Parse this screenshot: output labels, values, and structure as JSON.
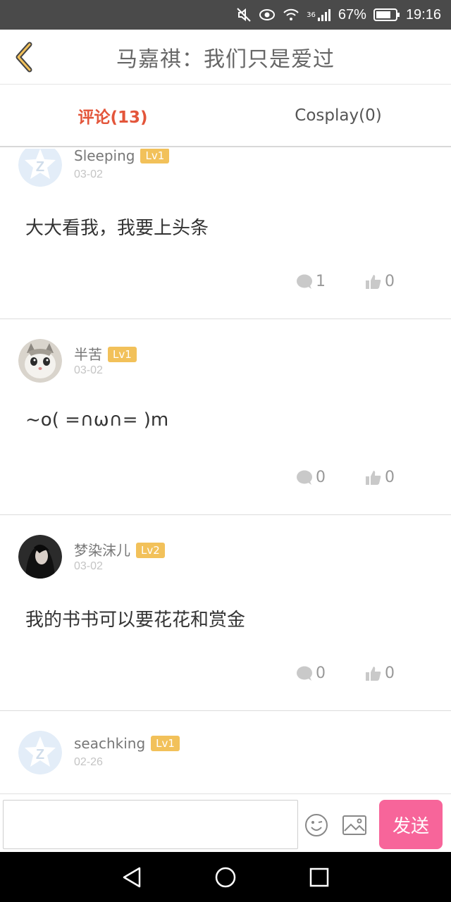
{
  "status_bar": {
    "battery": "67%",
    "time": "19:16",
    "network": "36"
  },
  "header": {
    "title": "马嘉祺：我们只是爱过"
  },
  "tabs": [
    {
      "label": "评论(13)",
      "active": true
    },
    {
      "label": "Cosplay(0)",
      "active": false
    }
  ],
  "comments": [
    {
      "username": "Sleeping",
      "level": "Lv1",
      "date": "03-02",
      "content": "大大看我，我要上头条",
      "reply_count": "1",
      "like_count": "0",
      "avatar": "default-avatar"
    },
    {
      "username": "半苦",
      "level": "Lv1",
      "date": "03-02",
      "content": "~o( =∩ω∩= )m",
      "reply_count": "0",
      "like_count": "0",
      "avatar": "cat-avatar"
    },
    {
      "username": "梦染沫儿",
      "level": "Lv2",
      "date": "03-02",
      "content": "我的书书可以要花花和赏金",
      "reply_count": "0",
      "like_count": "0",
      "avatar": "girl-avatar"
    },
    {
      "username": "seachking",
      "level": "Lv1",
      "date": "02-26",
      "content": "",
      "avatar": "default-avatar"
    }
  ],
  "input_bar": {
    "placeholder": "",
    "send_label": "发送"
  },
  "colors": {
    "accent": "#e3553a",
    "send": "#f7659a",
    "level_badge": "#f2c15a"
  }
}
